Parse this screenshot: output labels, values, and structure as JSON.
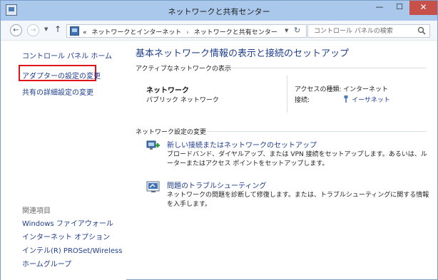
{
  "window": {
    "title": "ネットワークと共有センター",
    "minimize_label": "—",
    "maximize_label": "☐",
    "close_label": "✕"
  },
  "address": {
    "prefix": "«",
    "crumbs": [
      "ネットワークとインターネット",
      "ネットワークと共有センター"
    ],
    "separator": "›",
    "search_placeholder": "コントロール パネルの検索"
  },
  "sidebar": {
    "home_link": "コントロール パネル ホーム",
    "adapter_link": "アダプターの設定の変更",
    "sharing_link": "共有の詳細設定の変更",
    "highlight_color": "#e0141b",
    "related_title": "関連項目",
    "related_links": [
      "Windows ファイアウォール",
      "インターネット オプション",
      "インテル(R) PROSet/Wireless",
      "ホームグループ"
    ]
  },
  "main": {
    "title": "基本ネットワーク情報の表示と接続のセットアップ",
    "active_networks_label": "アクティブなネットワークの表示",
    "network_name": "ネットワーク",
    "network_type": "パブリック ネットワーク",
    "access_type_label": "アクセスの種類:",
    "access_type_value": "インターネット",
    "connections_label": "接続:",
    "connections_value": "イーサネット",
    "settings_label": "ネットワーク設定の変更",
    "tasks": [
      {
        "icon": "new-connection-icon",
        "link": "新しい接続またはネットワークのセットアップ",
        "description": "ブロードバンド、ダイヤルアップ、または VPN 接続をセットアップします。あるいは、ルーターまたはアクセス ポイントをセットアップします。"
      },
      {
        "icon": "troubleshoot-icon",
        "link": "問題のトラブルシューティング",
        "description": "ネットワークの問題を診断して修復します。または、トラブルシューティングに関する情報を入手します。"
      }
    ]
  },
  "colors": {
    "link": "#1f3c8f",
    "title": "#1e3f8e",
    "titlebar": "#a9c8eb",
    "close_button": "#c7504a"
  }
}
